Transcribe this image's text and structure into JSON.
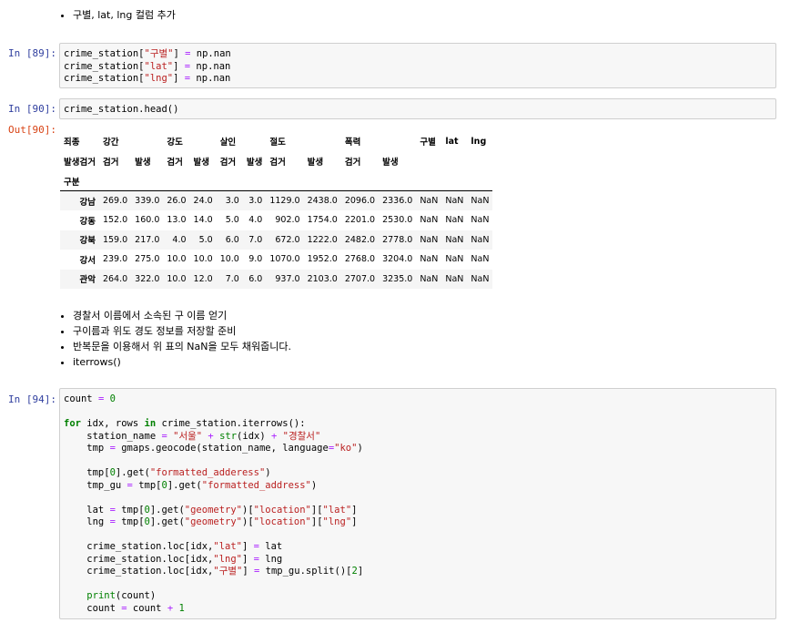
{
  "md1": [
    "구별, lat, lng 컬럼 추가"
  ],
  "cell89": {
    "prompt": "In [89]:",
    "lines": [
      [
        [
          "",
          "crime_station["
        ],
        [
          "str",
          "\"구별\""
        ],
        [
          "",
          "] "
        ],
        [
          "op",
          "="
        ],
        [
          "",
          " np.nan"
        ]
      ],
      [
        [
          "",
          "crime_station["
        ],
        [
          "str",
          "\"lat\""
        ],
        [
          "",
          "] "
        ],
        [
          "op",
          "="
        ],
        [
          "",
          " np.nan"
        ]
      ],
      [
        [
          "",
          "crime_station["
        ],
        [
          "str",
          "\"lng\""
        ],
        [
          "",
          "] "
        ],
        [
          "op",
          "="
        ],
        [
          "",
          " np.nan"
        ]
      ]
    ]
  },
  "cell90": {
    "prompt": "In [90]:",
    "lines": [
      [
        [
          "",
          "crime_station.head()"
        ]
      ]
    ]
  },
  "out90": {
    "prompt": "Out[90]:",
    "header1": [
      "죄종",
      "강간",
      "",
      "강도",
      "",
      "살인",
      "",
      "절도",
      "",
      "폭력",
      "",
      "구별",
      "lat",
      "lng"
    ],
    "header2": [
      "발생검거",
      "검거",
      "발생",
      "검거",
      "발생",
      "검거",
      "발생",
      "검거",
      "발생",
      "검거",
      "발생",
      "",
      "",
      ""
    ],
    "index_name": "구분",
    "rows": [
      {
        "idx": "강남",
        "vals": [
          "269.0",
          "339.0",
          "26.0",
          "24.0",
          "3.0",
          "3.0",
          "1129.0",
          "2438.0",
          "2096.0",
          "2336.0",
          "NaN",
          "NaN",
          "NaN"
        ]
      },
      {
        "idx": "강동",
        "vals": [
          "152.0",
          "160.0",
          "13.0",
          "14.0",
          "5.0",
          "4.0",
          "902.0",
          "1754.0",
          "2201.0",
          "2530.0",
          "NaN",
          "NaN",
          "NaN"
        ]
      },
      {
        "idx": "강북",
        "vals": [
          "159.0",
          "217.0",
          "4.0",
          "5.0",
          "6.0",
          "7.0",
          "672.0",
          "1222.0",
          "2482.0",
          "2778.0",
          "NaN",
          "NaN",
          "NaN"
        ]
      },
      {
        "idx": "강서",
        "vals": [
          "239.0",
          "275.0",
          "10.0",
          "10.0",
          "10.0",
          "9.0",
          "1070.0",
          "1952.0",
          "2768.0",
          "3204.0",
          "NaN",
          "NaN",
          "NaN"
        ]
      },
      {
        "idx": "관악",
        "vals": [
          "264.0",
          "322.0",
          "10.0",
          "12.0",
          "7.0",
          "6.0",
          "937.0",
          "2103.0",
          "2707.0",
          "3235.0",
          "NaN",
          "NaN",
          "NaN"
        ]
      }
    ]
  },
  "md2": [
    "경찰서 이름에서 소속된 구 이름 얻기",
    "구이름과 위도 경도 정보를 저장할 준비",
    "반복문을 이용해서 위 표의 NaN을 모두 채워줍니다.",
    "iterrows()"
  ],
  "cell94": {
    "prompt": "In [94]:",
    "lines": [
      [
        [
          "",
          "count "
        ],
        [
          "op",
          "="
        ],
        [
          "",
          " "
        ],
        [
          "num",
          "0"
        ]
      ],
      [],
      [
        [
          "kw",
          "for"
        ],
        [
          "",
          " idx, rows "
        ],
        [
          "kw",
          "in"
        ],
        [
          "",
          " crime_station.iterrows():"
        ]
      ],
      [
        [
          "",
          "    station_name "
        ],
        [
          "op",
          "="
        ],
        [
          "",
          " "
        ],
        [
          "str",
          "\"서울\""
        ],
        [
          "",
          " "
        ],
        [
          "op",
          "+"
        ],
        [
          "",
          " "
        ],
        [
          "bi",
          "str"
        ],
        [
          "",
          "(idx) "
        ],
        [
          "op",
          "+"
        ],
        [
          "",
          " "
        ],
        [
          "str",
          "\"경찰서\""
        ]
      ],
      [
        [
          "",
          "    tmp "
        ],
        [
          "op",
          "="
        ],
        [
          "",
          " gmaps.geocode(station_name, language"
        ],
        [
          "op",
          "="
        ],
        [
          "str",
          "\"ko\""
        ],
        [
          "",
          ")"
        ]
      ],
      [],
      [
        [
          "",
          "    tmp["
        ],
        [
          "num",
          "0"
        ],
        [
          "",
          "].get("
        ],
        [
          "str",
          "\"formatted_adderess\""
        ],
        [
          "",
          ")"
        ]
      ],
      [
        [
          "",
          "    tmp_gu "
        ],
        [
          "op",
          "="
        ],
        [
          "",
          " tmp["
        ],
        [
          "num",
          "0"
        ],
        [
          "",
          "].get("
        ],
        [
          "str",
          "\"formatted_address\""
        ],
        [
          "",
          ")"
        ]
      ],
      [],
      [
        [
          "",
          "    lat "
        ],
        [
          "op",
          "="
        ],
        [
          "",
          " tmp["
        ],
        [
          "num",
          "0"
        ],
        [
          "",
          "].get("
        ],
        [
          "str",
          "\"geometry\""
        ],
        [
          "",
          ")["
        ],
        [
          "str",
          "\"location\""
        ],
        [
          "",
          "]["
        ],
        [
          "str",
          "\"lat\""
        ],
        [
          "",
          "]"
        ]
      ],
      [
        [
          "",
          "    lng "
        ],
        [
          "op",
          "="
        ],
        [
          "",
          " tmp["
        ],
        [
          "num",
          "0"
        ],
        [
          "",
          "].get("
        ],
        [
          "str",
          "\"geometry\""
        ],
        [
          "",
          ")["
        ],
        [
          "str",
          "\"location\""
        ],
        [
          "",
          "]["
        ],
        [
          "str",
          "\"lng\""
        ],
        [
          "",
          "]"
        ]
      ],
      [],
      [
        [
          "",
          "    crime_station.loc[idx,"
        ],
        [
          "str",
          "\"lat\""
        ],
        [
          "",
          "] "
        ],
        [
          "op",
          "="
        ],
        [
          "",
          " lat"
        ]
      ],
      [
        [
          "",
          "    crime_station.loc[idx,"
        ],
        [
          "str",
          "\"lng\""
        ],
        [
          "",
          "] "
        ],
        [
          "op",
          "="
        ],
        [
          "",
          " lng"
        ]
      ],
      [
        [
          "",
          "    crime_station.loc[idx,"
        ],
        [
          "str",
          "\"구별\""
        ],
        [
          "",
          "] "
        ],
        [
          "op",
          "="
        ],
        [
          "",
          " tmp_gu.split()["
        ],
        [
          "num",
          "2"
        ],
        [
          "",
          "]"
        ]
      ],
      [],
      [
        [
          "",
          "    "
        ],
        [
          "bi",
          "print"
        ],
        [
          "",
          "(count)"
        ]
      ],
      [
        [
          "",
          "    count "
        ],
        [
          "op",
          "="
        ],
        [
          "",
          " count "
        ],
        [
          "op",
          "+"
        ],
        [
          "",
          " "
        ],
        [
          "num",
          "1"
        ]
      ]
    ]
  }
}
